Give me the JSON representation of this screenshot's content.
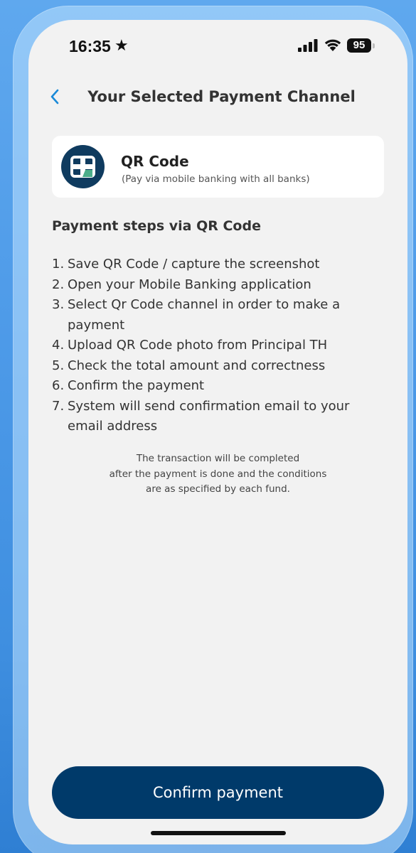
{
  "status_bar": {
    "time": "16:35",
    "battery": "95",
    "icons": [
      "star-icon",
      "signal-icon",
      "wifi-icon",
      "battery-icon"
    ]
  },
  "header": {
    "back_icon": "chevron-left-icon",
    "title": "Your Selected Payment Channel"
  },
  "channel": {
    "icon": "qr-logo-icon",
    "name": "QR Code",
    "description": "(Pay via mobile banking with all banks)"
  },
  "steps": {
    "heading": "Payment steps via QR Code",
    "items": [
      {
        "num": "1.",
        "text": "Save QR Code / capture the screenshot"
      },
      {
        "num": "2.",
        "text": "Open your Mobile Banking application"
      },
      {
        "num": "3.",
        "text": "Select Qr Code channel in order to make a payment"
      },
      {
        "num": "4.",
        "text": "Upload QR Code photo from Principal TH"
      },
      {
        "num": "5.",
        "text": "Check the total amount and correctness"
      },
      {
        "num": "6.",
        "text": "Confirm the payment"
      },
      {
        "num": "7.",
        "text": "System will send confirmation email to your email address"
      }
    ]
  },
  "note": {
    "lines": [
      "The transaction will be completed",
      "after the payment is done and the conditions",
      "are as specified by each fund."
    ]
  },
  "confirm_button": {
    "label": "Confirm payment"
  },
  "colors": {
    "primary": "#003a6a",
    "accent": "#1a8ad8",
    "screen_bg": "#f2f2f2",
    "card_bg": "#ffffff"
  }
}
